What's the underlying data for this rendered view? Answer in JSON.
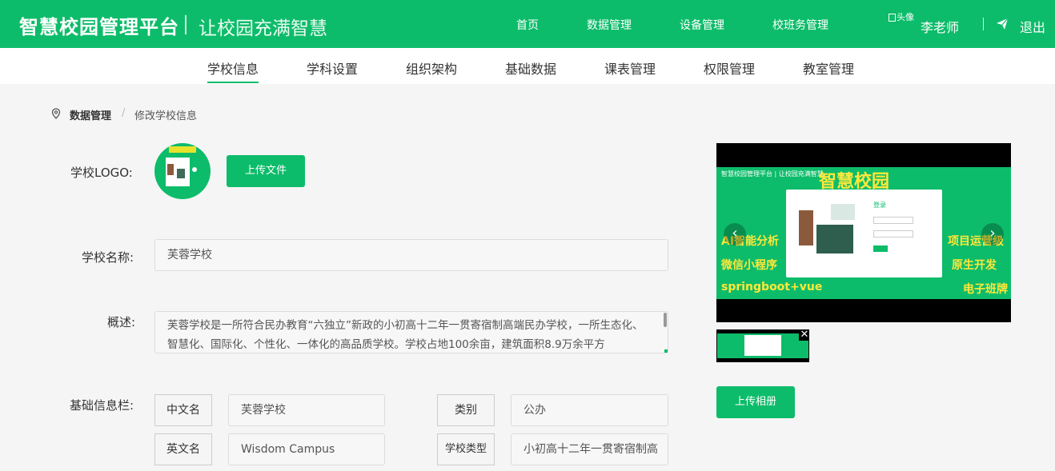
{
  "header": {
    "brand": "智慧校园管理平台",
    "slogan": "让校园充满智慧",
    "nav": [
      "首页",
      "数据管理",
      "设备管理",
      "校班务管理"
    ],
    "avatar_alt": "头像",
    "username": "李老师",
    "logout": "退出"
  },
  "subnav": {
    "items": [
      "学校信息",
      "学科设置",
      "组织架构",
      "基础数据",
      "课表管理",
      "权限管理",
      "教室管理"
    ],
    "active": "学校信息"
  },
  "breadcrumb": {
    "parent": "数据管理",
    "separator": "/",
    "current": "修改学校信息"
  },
  "form": {
    "logo_label": "学校LOGO:",
    "upload_file": "上传文件",
    "name_label": "学校名称:",
    "name_value": "芙蓉学校",
    "summary_label": "概述:",
    "summary_value": "芙蓉学校是一所符合民办教育“六独立”新政的小初高十二年一贯寄宿制高端民办学校，一所生态化、智慧化、国际化、个性化、一体化的高品质学校。学校占地100余亩，建筑面积8.9万余平方",
    "basic_label": "基础信息栏:",
    "cn_name_tag": "中文名",
    "cn_name_value": "芙蓉学校",
    "category_tag": "类别",
    "category_value": "公办",
    "en_name_tag": "英文名",
    "en_name_value": "Wisdom Campus",
    "school_type_tag": "学校类型",
    "school_type_value": "小初高十二年一贯寄宿制高"
  },
  "gallery": {
    "slide_top": "智慧校园管理平台 | 让校园充满智慧",
    "slide_title": "智慧校园",
    "slide_login": "登录",
    "left_lines": [
      "AI智能分析",
      "微信小程序",
      "springboot+vue"
    ],
    "right_lines": [
      "项目运营级",
      "原生开发",
      "电子班牌"
    ],
    "prev": "‹",
    "next": "›",
    "thumb_close": "✕",
    "upload_album": "上传相册"
  },
  "colors": {
    "primary": "#0dbc6a",
    "accent_text": "#ffe83a"
  }
}
